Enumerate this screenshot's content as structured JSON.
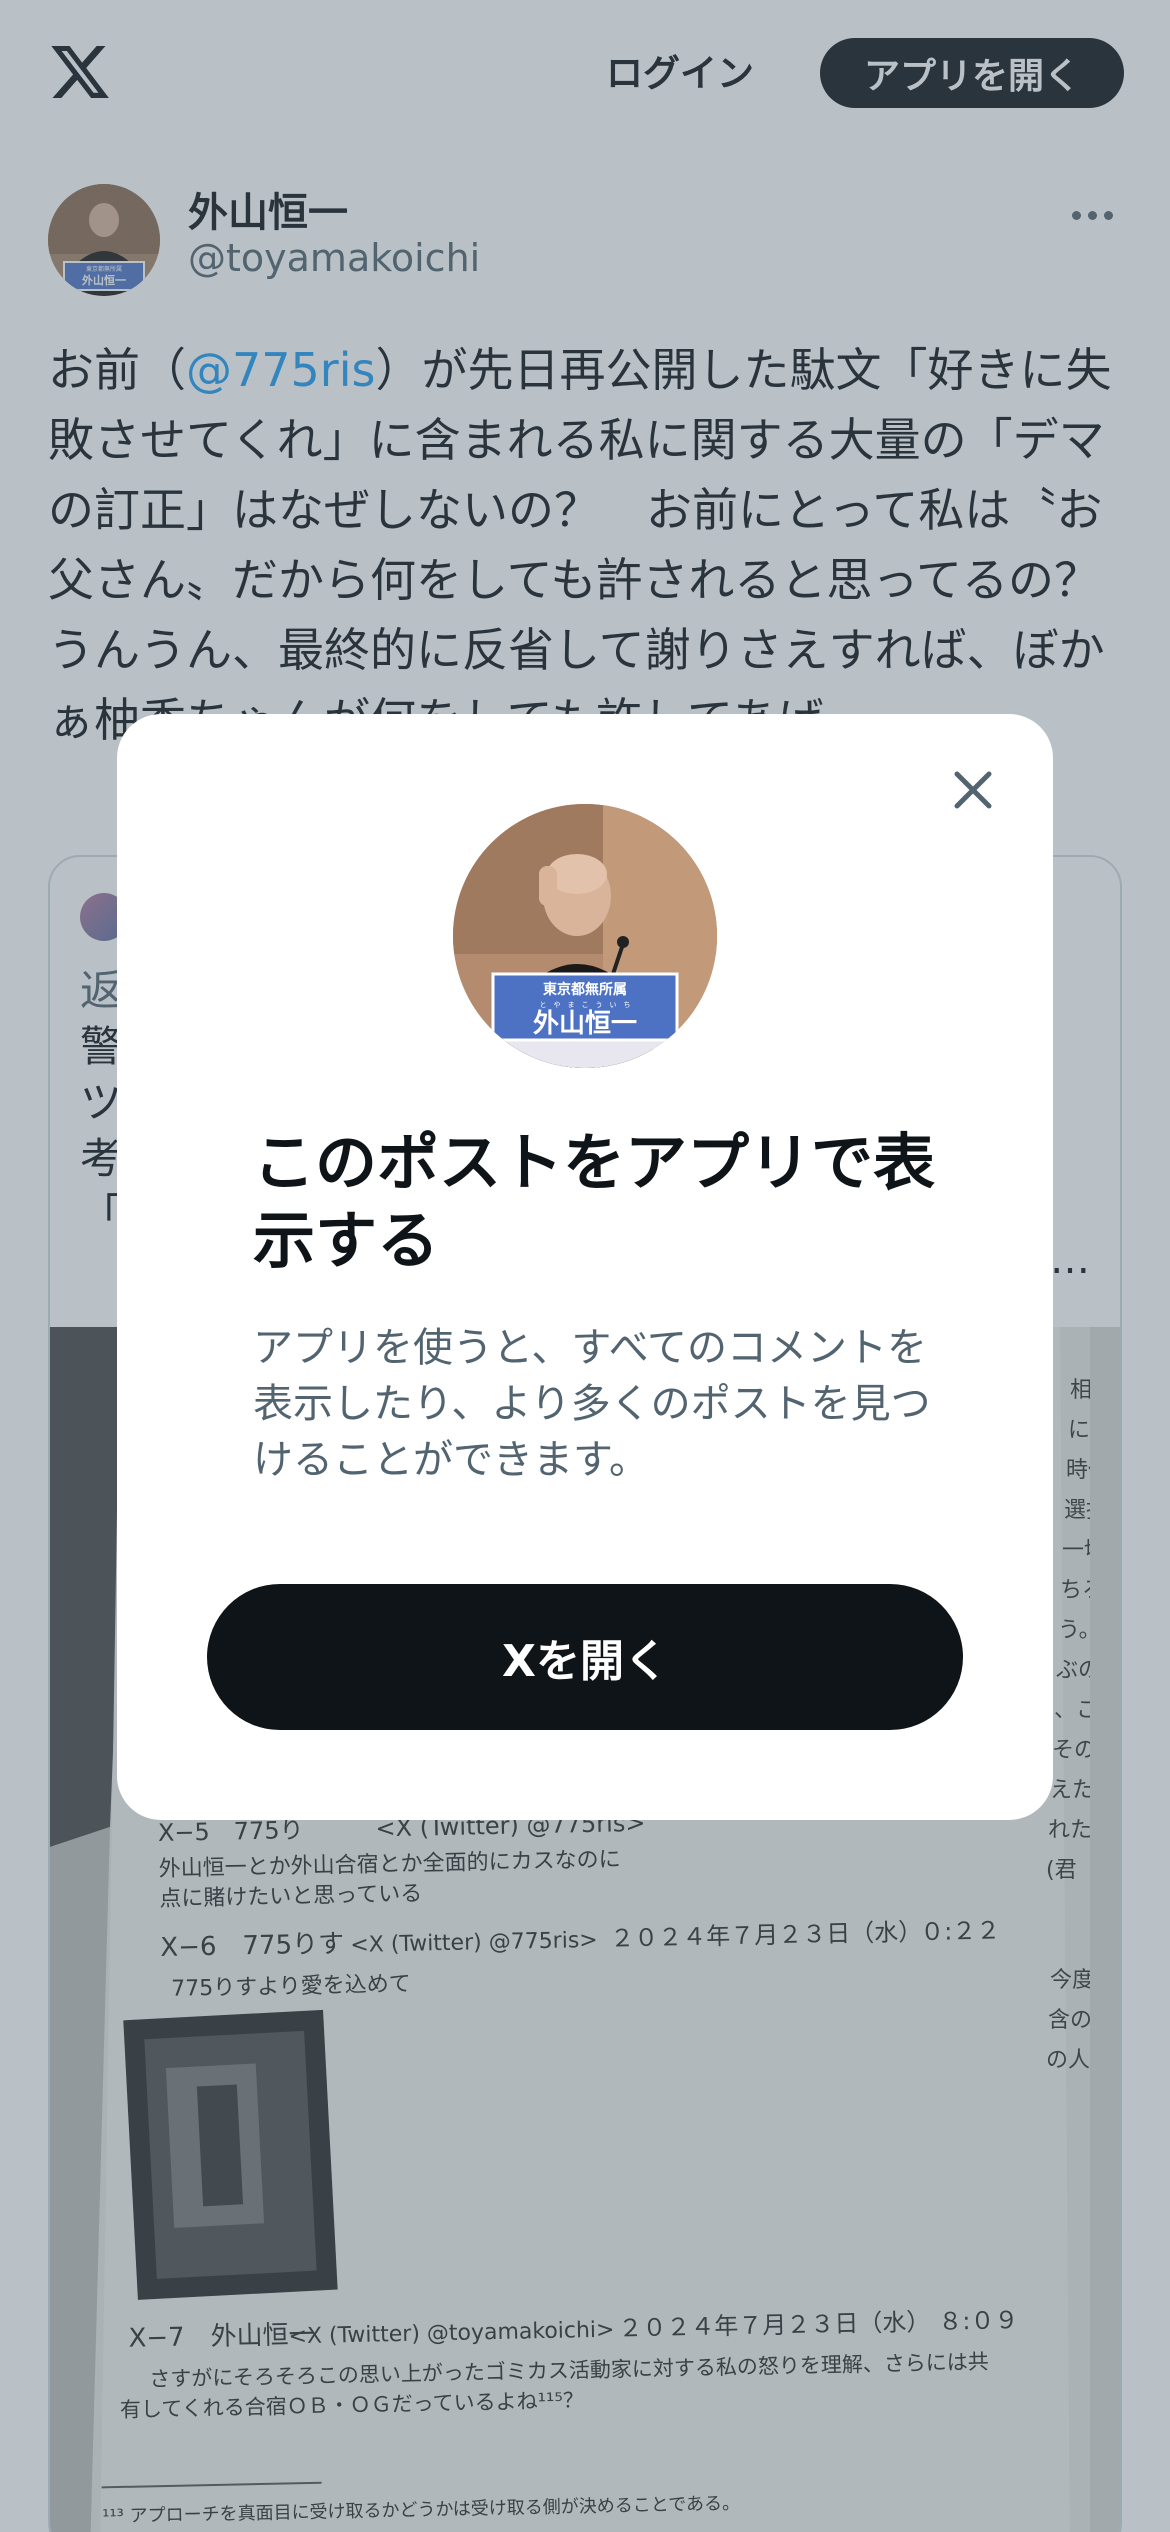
{
  "header": {
    "logo_icon": "x-logo-icon",
    "login_label": "ログイン",
    "open_app_label": "アプリを開く"
  },
  "tweet": {
    "author_name": "外山恒一",
    "author_handle": "@toyamakoichi",
    "avatar_nameplate_org": "東京都無所属",
    "avatar_nameplate_name": "外山恒一",
    "text_before_mention": "お前（",
    "mention": "@775ris",
    "text_after_mention": "）が先日再公開した駄文「好きに失敗させてくれ」に含まれる私に関する大量の「デマの訂正」はなぜしないの？　お前にとって私は〝お父さん〟だから何をしても許されると思ってるの？　うんうん、最終的に反省して謝りさえすれば、ぼかぁ柚香ちゃんが何をしても許してあげ"
  },
  "quote": {
    "lines": [
      "返",
      "警",
      "ツ",
      "考",
      "「"
    ],
    "ellipsis": "…",
    "photo": {
      "line_x5": "X−5　775り　　　<X (Twitter) @775ris>",
      "line_x5_body1": "外山恒一とか外山合宿とか全面的にカスなのに",
      "line_x5_body2": "点に賭けたいと思っている",
      "line_x6": "X−6　775りす",
      "line_x6_src": "<X (Twitter) @775ris>",
      "line_x6_date": "２０２４年７月２３日（水）",
      "line_x6_time": "０:２２",
      "line_x6_body": "775りすより愛を込めて",
      "line_x7": "X−7　外山恒一",
      "line_x7_src": "<X (Twitter) @toyamakoichi>",
      "line_x7_date": "２０２４年７月２３日（水）",
      "line_x7_time": "８:０９",
      "line_x7_body1": "さすがにそろそろこの思い上がったゴミカス活動家に対する私の怒りを理解、さらには共",
      "line_x7_body2": "有してくれる合宿ＯＢ・ＯＧだっているよね¹¹⁵？",
      "footnote": "¹¹³ アプローチを真面目に受け取るかどうかは受け取る側が決めることである。",
      "right_col": [
        "相変わ",
        "に遭遇",
        "時代の",
        "選択肢",
        "一切の",
        "ちろん、",
        "う。",
        "ぶのは",
        "、ここまで",
        "その",
        "えた我",
        "れた",
        "(君",
        "今度",
        "含の",
        "の人生"
      ]
    }
  },
  "modal": {
    "close_icon": "close-icon",
    "nameplate_org": "東京都無所属",
    "nameplate_ruby": "と　や　ま　こ　う　い　ち",
    "nameplate_name": "外山恒一",
    "title": "このポストをアプリで表示する",
    "description": "アプリを使うと、すべてのコメントを表示したり、より多くのポストを見つけることができます。",
    "cta_label": "Xを開く"
  },
  "colors": {
    "primary_text": "#0f1419",
    "secondary_text": "#536471",
    "mention": "#1d9bf0",
    "overlay": "rgba(83,100,113,0.40)",
    "button_dark": "#0f1419"
  }
}
